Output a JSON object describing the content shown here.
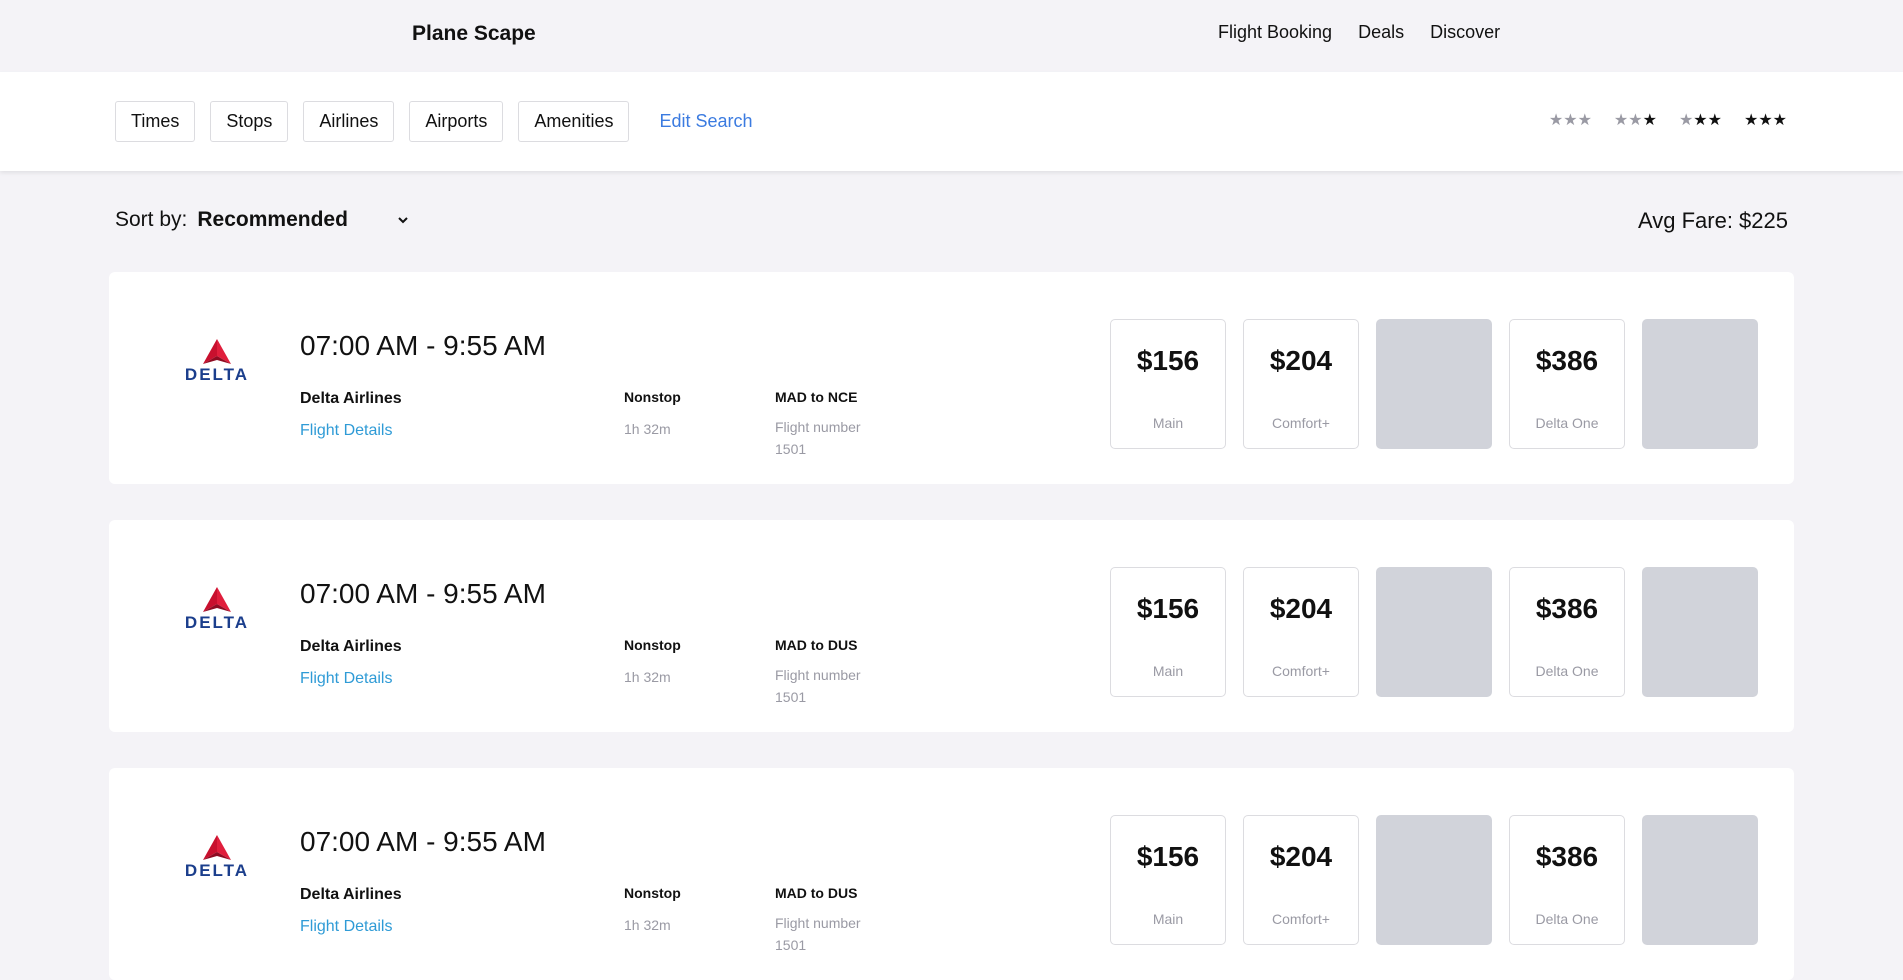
{
  "header": {
    "brand": "Plane Scape",
    "nav": [
      "Flight Booking",
      "Deals",
      "Discover"
    ]
  },
  "filters": {
    "buttons": [
      "Times",
      "Stops",
      "Airlines",
      "Airports",
      "Amenities"
    ],
    "edit_search": "Edit Search",
    "star_ratings": [
      0,
      1,
      2,
      3
    ]
  },
  "sort": {
    "label": "Sort by:",
    "value": "Recommended"
  },
  "avg_fare": "Avg Fare: $225",
  "flights": [
    {
      "logo_text": "DELTA",
      "times": "07:00 AM - 9:55 AM",
      "airline": "Delta Airlines",
      "details_link": "Flight Details",
      "stops": "Nonstop",
      "duration": "1h 32m",
      "route": "MAD to NCE",
      "flight_number": "Flight number 1501",
      "fares": [
        {
          "price": "$156",
          "class": "Main"
        },
        {
          "price": "$204",
          "class": "Comfort+"
        },
        {
          "price": "",
          "class": ""
        },
        {
          "price": "$386",
          "class": "Delta One"
        },
        {
          "price": "",
          "class": ""
        }
      ]
    },
    {
      "logo_text": "DELTA",
      "times": "07:00 AM - 9:55 AM",
      "airline": "Delta Airlines",
      "details_link": "Flight Details",
      "stops": "Nonstop",
      "duration": "1h 32m",
      "route": "MAD to DUS",
      "flight_number": "Flight number 1501",
      "fares": [
        {
          "price": "$156",
          "class": "Main"
        },
        {
          "price": "$204",
          "class": "Comfort+"
        },
        {
          "price": "",
          "class": ""
        },
        {
          "price": "$386",
          "class": "Delta One"
        },
        {
          "price": "",
          "class": ""
        }
      ]
    },
    {
      "logo_text": "DELTA",
      "times": "07:00 AM - 9:55 AM",
      "airline": "Delta Airlines",
      "details_link": "Flight Details",
      "stops": "Nonstop",
      "duration": "1h 32m",
      "route": "MAD to DUS",
      "flight_number": "Flight number 1501",
      "fares": [
        {
          "price": "$156",
          "class": "Main"
        },
        {
          "price": "$204",
          "class": "Comfort+"
        },
        {
          "price": "",
          "class": ""
        },
        {
          "price": "$386",
          "class": "Delta One"
        },
        {
          "price": "",
          "class": ""
        }
      ]
    }
  ]
}
